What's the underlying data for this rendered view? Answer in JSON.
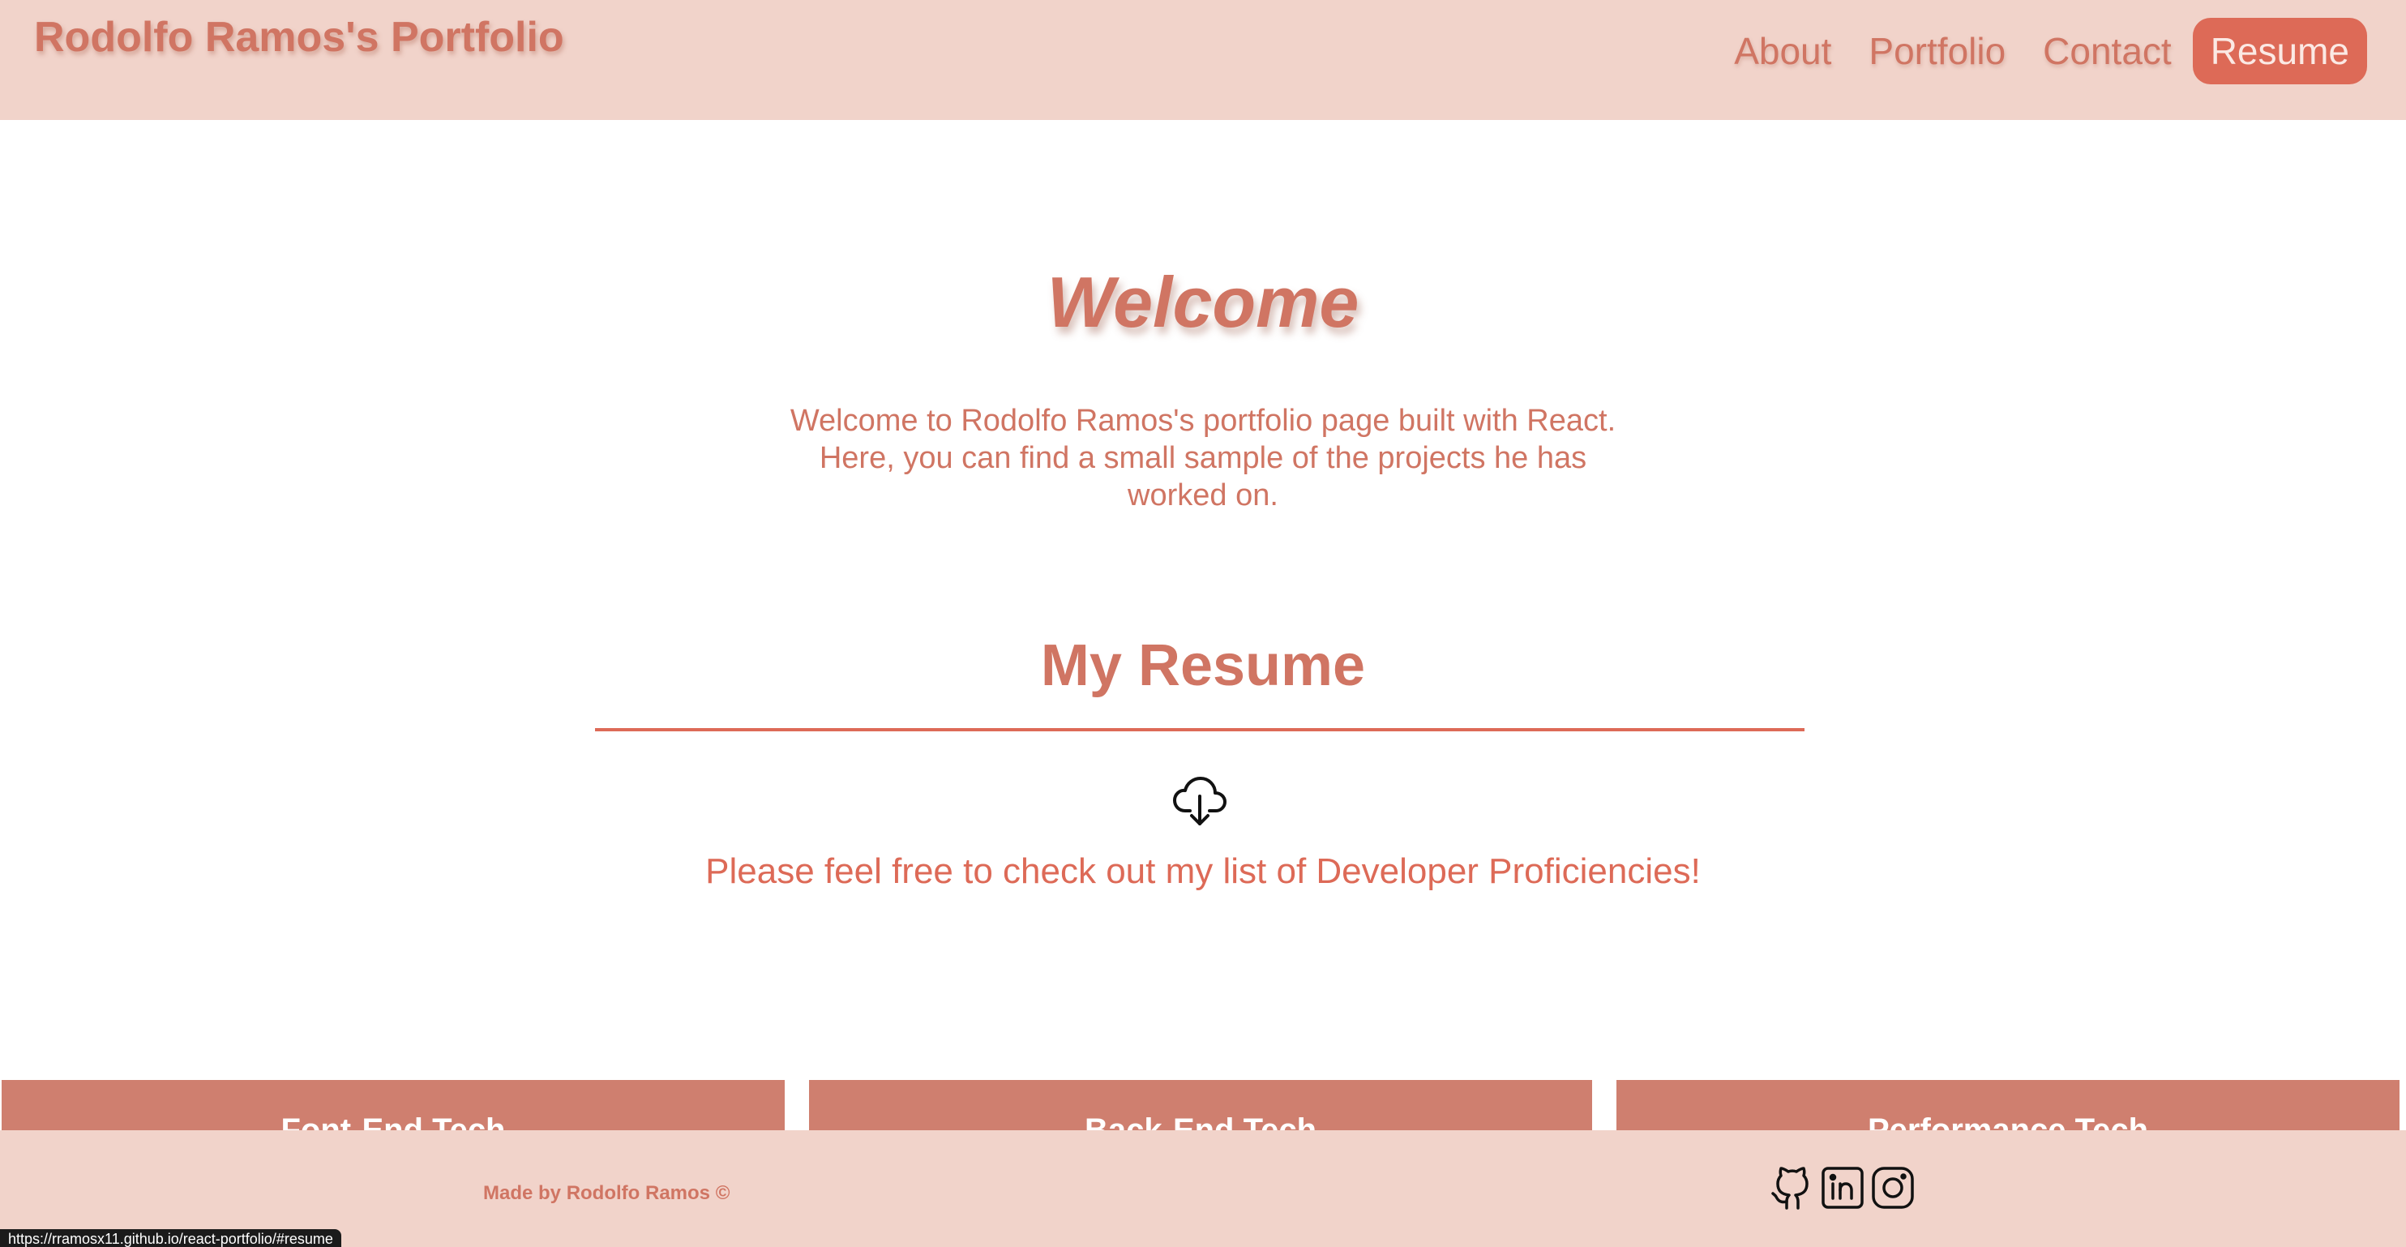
{
  "header": {
    "site_title": "Rodolfo Ramos's Portfolio",
    "nav": [
      {
        "label": "About",
        "active": false
      },
      {
        "label": "Portfolio",
        "active": false
      },
      {
        "label": "Contact",
        "active": false
      },
      {
        "label": "Resume",
        "active": true
      }
    ]
  },
  "welcome": {
    "title": "Welcome",
    "text": "Welcome to Rodolfo Ramos's portfolio page built with React. Here, you can find a small sample of the projects he has worked on."
  },
  "resume": {
    "title": "My Resume",
    "download_icon": "cloud-download-icon",
    "proficiencies_text": "Please feel free to check out my list of Developer Proficiencies!"
  },
  "cards": [
    {
      "title": "Font-End Tech"
    },
    {
      "title": "Back-End Tech"
    },
    {
      "title": "Performance Tech"
    }
  ],
  "footer": {
    "credit": "Made by Rodolfo Ramos ©",
    "social_icons": [
      "github-icon",
      "linkedin-icon",
      "instagram-icon"
    ]
  },
  "status_bar": {
    "url": "https://rramosx11.github.io/react-portfolio/#resume"
  },
  "colors": {
    "accent": "#dd6a57",
    "text": "#d07563",
    "header_bg": "#f1d3ca",
    "card_bg": "#cf7f6f"
  }
}
